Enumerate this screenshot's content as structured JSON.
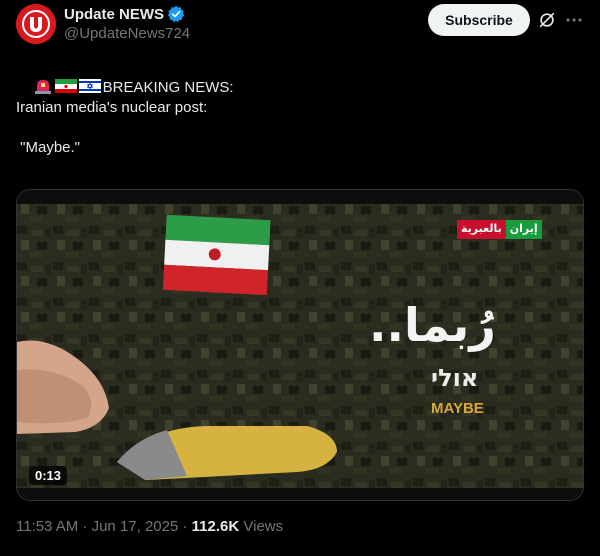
{
  "author": {
    "display_name": "Update NEWS",
    "handle": "@UpdateNews724",
    "avatar_letter": "U",
    "avatar_color": "#d71920",
    "verified_icon": "verified-badge-icon"
  },
  "actions": {
    "subscribe_label": "Subscribe",
    "grok_icon": "grok-icon",
    "more_icon": "more-icon"
  },
  "tweet": {
    "emoji_prefix": [
      "siren-emoji",
      "iran-flag-emoji",
      "israel-flag-emoji"
    ],
    "line1": "BREAKING NEWS:",
    "line2": "Iranian media's nuclear post:",
    "line3": " \"Maybe.\""
  },
  "media": {
    "duration": "0:13",
    "overlay_ar": "رُبما..",
    "overlay_he": "אולי",
    "overlay_en": "MAYBE",
    "channel_logo_red": "بالعبرية",
    "channel_logo_green": "إيران"
  },
  "meta": {
    "timestamp": "11:53 AM · Jun 17, 2025 · ",
    "views_count": "112.6K",
    "views_label": " Views"
  },
  "colors": {
    "background": "#000000",
    "text": "#e7e9ea",
    "muted": "#71767b",
    "verified": "#1d9bf0"
  }
}
